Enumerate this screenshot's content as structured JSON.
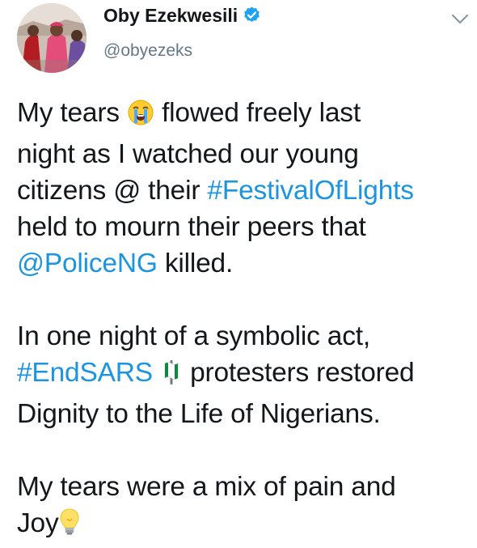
{
  "author": {
    "display_name": "Oby Ezekwesili",
    "handle": "@obyezeks",
    "verified": true
  },
  "icons": {
    "verified": "verified-badge-icon",
    "more": "chevron-down-icon",
    "crying": "loudly-crying-face-emoji",
    "flag": "nigeria-flag-emoji",
    "bulb": "light-bulb-emoji"
  },
  "colors": {
    "link": "#1b95e0",
    "text": "#14171a",
    "handle": "#657786",
    "verified": "#1da1f2"
  },
  "tweet": {
    "p1": {
      "l1_a": "My tears",
      "l1_b": "flowed freely last",
      "l2": "night as I watched our young",
      "l3_a": "citizens @ their",
      "l3_hashtag": "#FestivalOfLights",
      "l4": "held to mourn their peers that",
      "l5_mention": "@PoliceNG",
      "l5_b": "killed."
    },
    "p2": {
      "l1": "In one night of a symbolic act,",
      "l2_hashtag": "#EndSARS",
      "l2_b": "protesters restored",
      "l3": "Dignity to the Life of Nigerians."
    },
    "p3": {
      "l1": "My tears were a mix of pain and",
      "l2_a": "Joy"
    }
  }
}
